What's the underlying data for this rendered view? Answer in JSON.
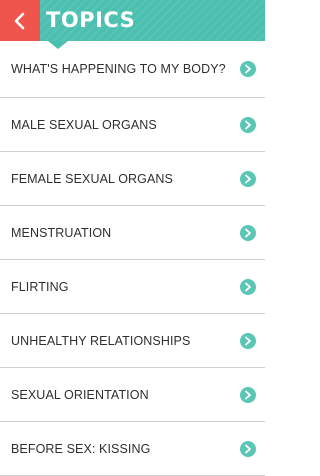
{
  "header": {
    "title": "TOPICS",
    "back_icon": "chevron-left-icon",
    "colors": {
      "bar": "#4cc0b0",
      "back_button": "#f0554d"
    }
  },
  "topics": [
    {
      "label": "WHAT'S HAPPENING TO MY BODY?",
      "icon": "chevron-right-circle-icon"
    },
    {
      "label": "MALE SEXUAL ORGANS",
      "icon": "chevron-right-circle-icon"
    },
    {
      "label": "FEMALE SEXUAL ORGANS",
      "icon": "chevron-right-circle-icon"
    },
    {
      "label": "MENSTRUATION",
      "icon": "chevron-right-circle-icon"
    },
    {
      "label": "FLIRTING",
      "icon": "chevron-right-circle-icon"
    },
    {
      "label": "UNHEALTHY RELATIONSHIPS",
      "icon": "chevron-right-circle-icon"
    },
    {
      "label": "SEXUAL ORIENTATION",
      "icon": "chevron-right-circle-icon"
    },
    {
      "label": "BEFORE SEX: KISSING",
      "icon": "chevron-right-circle-icon"
    }
  ]
}
